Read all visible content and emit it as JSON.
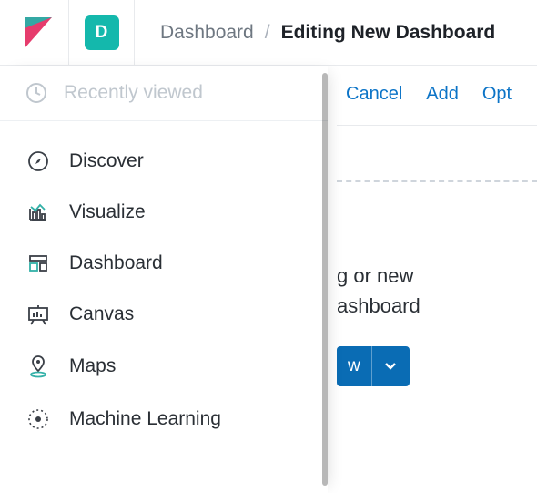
{
  "header": {
    "space_letter": "D",
    "breadcrumb_parent": "Dashboard",
    "breadcrumb_separator": "/",
    "breadcrumb_current": "Editing New Dashboard"
  },
  "sidebar": {
    "recent_label": "Recently viewed",
    "items": [
      {
        "label": "Discover"
      },
      {
        "label": "Visualize"
      },
      {
        "label": "Dashboard"
      },
      {
        "label": "Canvas"
      },
      {
        "label": "Maps"
      },
      {
        "label": "Machine Learning"
      }
    ]
  },
  "actions": {
    "cancel": "Cancel",
    "add": "Add",
    "options": "Opt"
  },
  "placeholder": {
    "line1_fragment": "g or new",
    "line2_fragment": "ashboard"
  },
  "button": {
    "label_fragment": "w"
  }
}
